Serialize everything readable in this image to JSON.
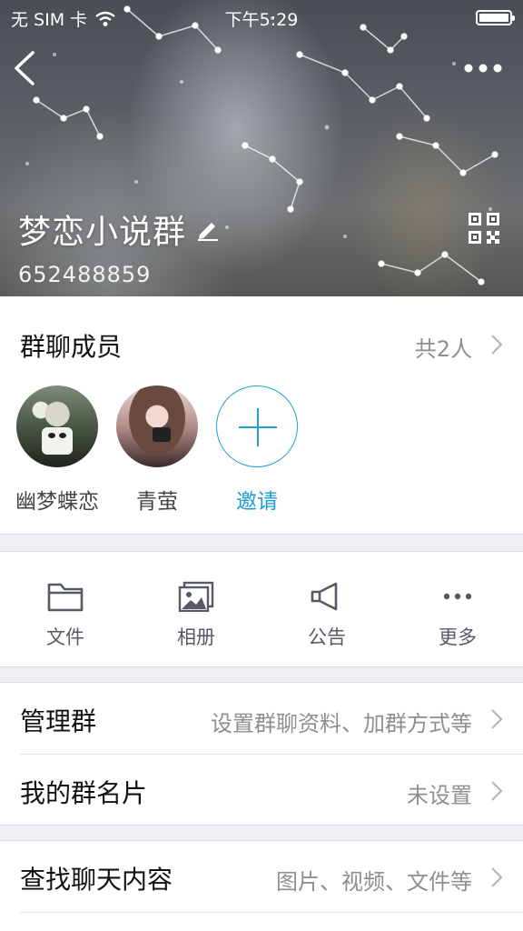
{
  "status_bar": {
    "carrier": "无 SIM 卡",
    "time": "下午5:29"
  },
  "header": {
    "group_name": "梦恋小说群",
    "group_id": "652488859",
    "icons": {
      "back": "back-chevron-icon",
      "more": "more-dots-icon",
      "edit": "pencil-icon",
      "qr": "qr-code-icon"
    }
  },
  "members": {
    "title": "群聊成员",
    "count_label": "共2人",
    "list": [
      {
        "name": "幽梦蝶恋"
      },
      {
        "name": "青萤"
      }
    ],
    "invite_label": "邀请"
  },
  "tools": [
    {
      "label": "文件",
      "icon": "folder-icon"
    },
    {
      "label": "相册",
      "icon": "album-icon"
    },
    {
      "label": "公告",
      "icon": "megaphone-icon"
    },
    {
      "label": "更多",
      "icon": "more-dots-icon"
    }
  ],
  "settings": {
    "manage": {
      "title": "管理群",
      "value": "设置群聊资料、加群方式等"
    },
    "card": {
      "title": "我的群名片",
      "value": "未设置"
    }
  },
  "search": {
    "title": "查找聊天内容",
    "value": "图片、视频、文件等"
  },
  "colors": {
    "accent": "#1e9fd8",
    "background": "#efeff4",
    "secondary_text": "#8e8e93"
  }
}
